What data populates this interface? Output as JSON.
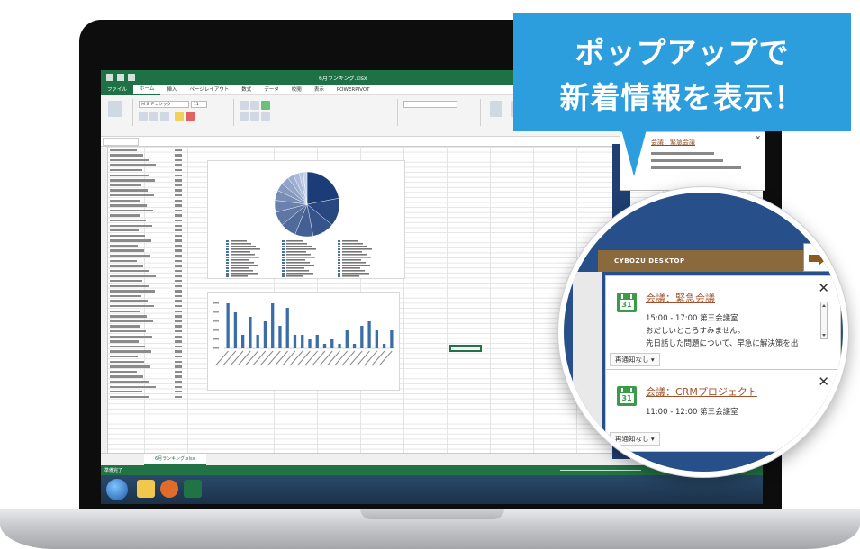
{
  "callout": {
    "line1": "ポップアップで",
    "line2": "新着情報を表示！"
  },
  "popup": {
    "header": "CYBOZU DESKTOP",
    "cards": [
      {
        "title": "会議：緊急会議",
        "time": "15:00 - 17:00 第三会議室",
        "body1": "おだしいところすみません。",
        "body2": "先日話した問題について、早急に解決策を出",
        "notify": "再通知なし ▾",
        "calendar_day": "31"
      },
      {
        "title": "会議：CRMプロジェクト",
        "time": "11:00 - 12:00 第三会議室",
        "notify": "再通知なし ▾",
        "calendar_day": "31"
      }
    ]
  },
  "excel": {
    "tabs": [
      "ファイル",
      "ホーム",
      "挿入",
      "ページレイアウト",
      "数式",
      "データ",
      "校閲",
      "表示",
      "POWERPIVOT"
    ],
    "font_name": "ＭＳ Ｐゴシック",
    "font_size": "11",
    "sheet_tab": "6月ランキング.xlsx",
    "status": "準備完了",
    "colors": {
      "excel_green": "#217346",
      "callout_blue": "#2c9ddd",
      "cybozu_brown": "#8a6a3c",
      "popup_bg": "#27508a"
    }
  },
  "chart_data": [
    {
      "type": "pie",
      "values": [
        22,
        14,
        11,
        9,
        8,
        7,
        6,
        5,
        4,
        4,
        3,
        3,
        2,
        2
      ],
      "title": ""
    },
    {
      "type": "bar",
      "values": [
        10,
        8,
        3,
        7,
        3,
        6,
        10,
        5,
        9,
        3,
        3,
        2,
        3,
        1,
        2,
        1,
        4,
        1,
        5,
        6,
        4,
        1,
        4
      ]
    }
  ]
}
